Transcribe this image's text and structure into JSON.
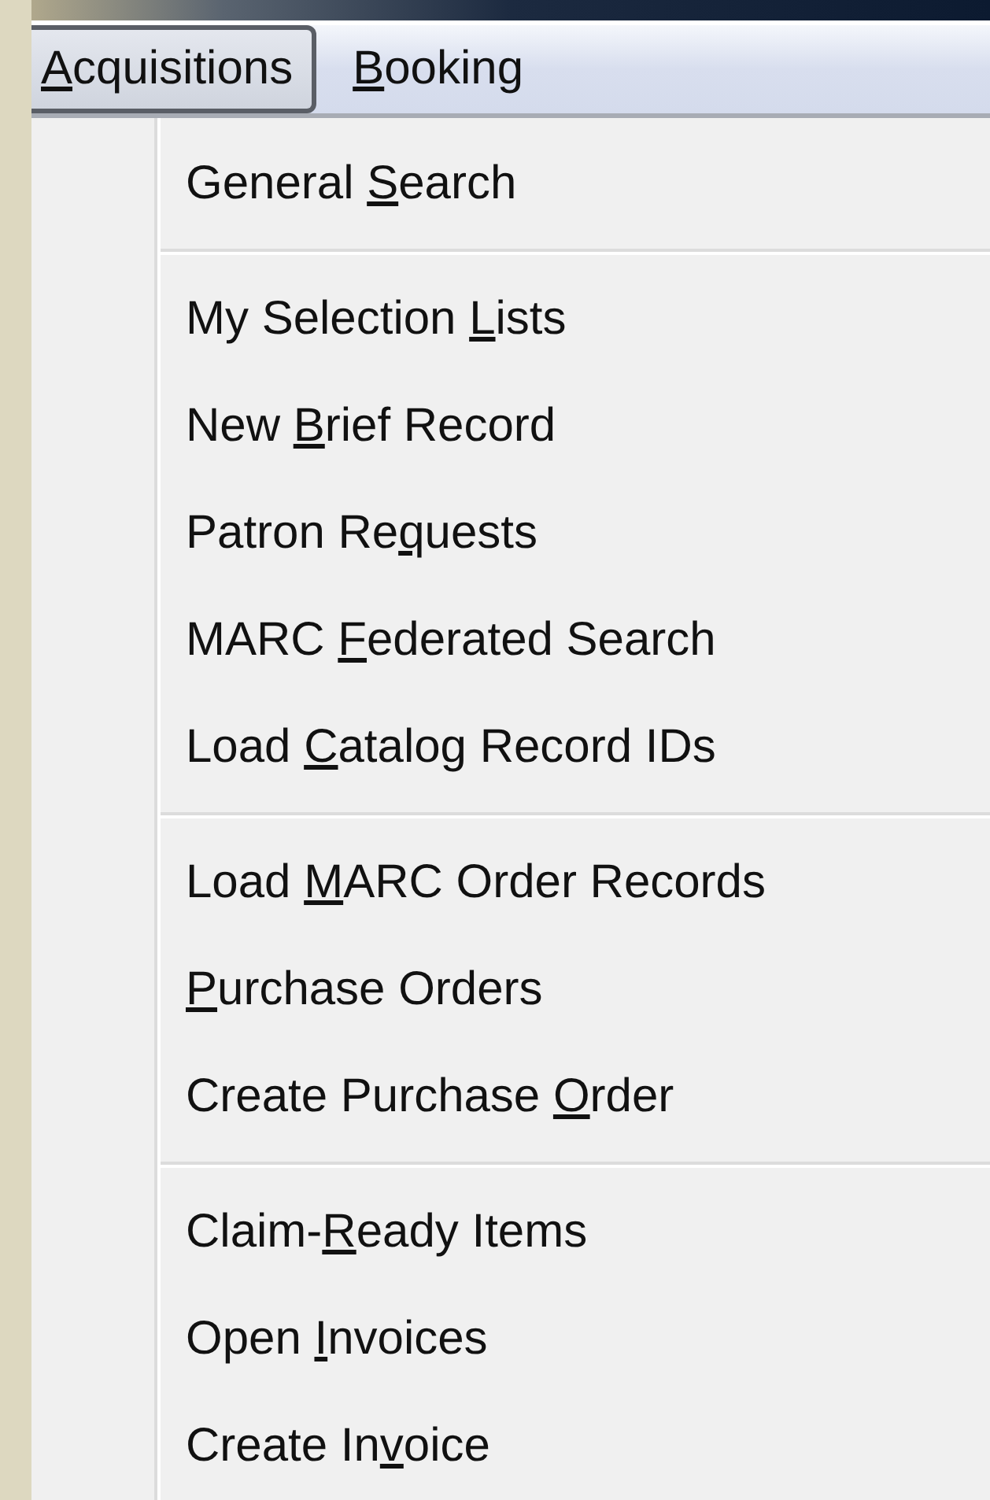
{
  "menu_bar": [
    {
      "key": "A",
      "post": "cquisitions",
      "selected": true
    },
    {
      "key": "B",
      "post": "ooking",
      "selected": false
    }
  ],
  "menu": {
    "groups": [
      {
        "items": [
          {
            "pre": "General ",
            "key": "S",
            "post": "earch"
          }
        ]
      },
      {
        "items": [
          {
            "pre": "My Selection ",
            "key": "L",
            "post": "ists"
          },
          {
            "pre": "New ",
            "key": "B",
            "post": "rief Record"
          },
          {
            "pre": "Patron Re",
            "key": "q",
            "post": "uests"
          },
          {
            "pre": "MARC ",
            "key": "F",
            "post": "ederated Search"
          },
          {
            "pre": "Load ",
            "key": "C",
            "post": "atalog Record IDs"
          }
        ]
      },
      {
        "items": [
          {
            "pre": "Load ",
            "key": "M",
            "post": "ARC Order Records"
          },
          {
            "key": "P",
            "post": "urchase Orders"
          },
          {
            "pre": "Create Purchase ",
            "key": "O",
            "post": "rder"
          }
        ]
      },
      {
        "items": [
          {
            "pre": "Claim-",
            "key": "R",
            "post": "eady Items"
          },
          {
            "pre": "Open ",
            "key": "I",
            "post": "nvoices"
          },
          {
            "pre": "Create In",
            "key": "v",
            "post": "oice"
          }
        ]
      }
    ]
  }
}
